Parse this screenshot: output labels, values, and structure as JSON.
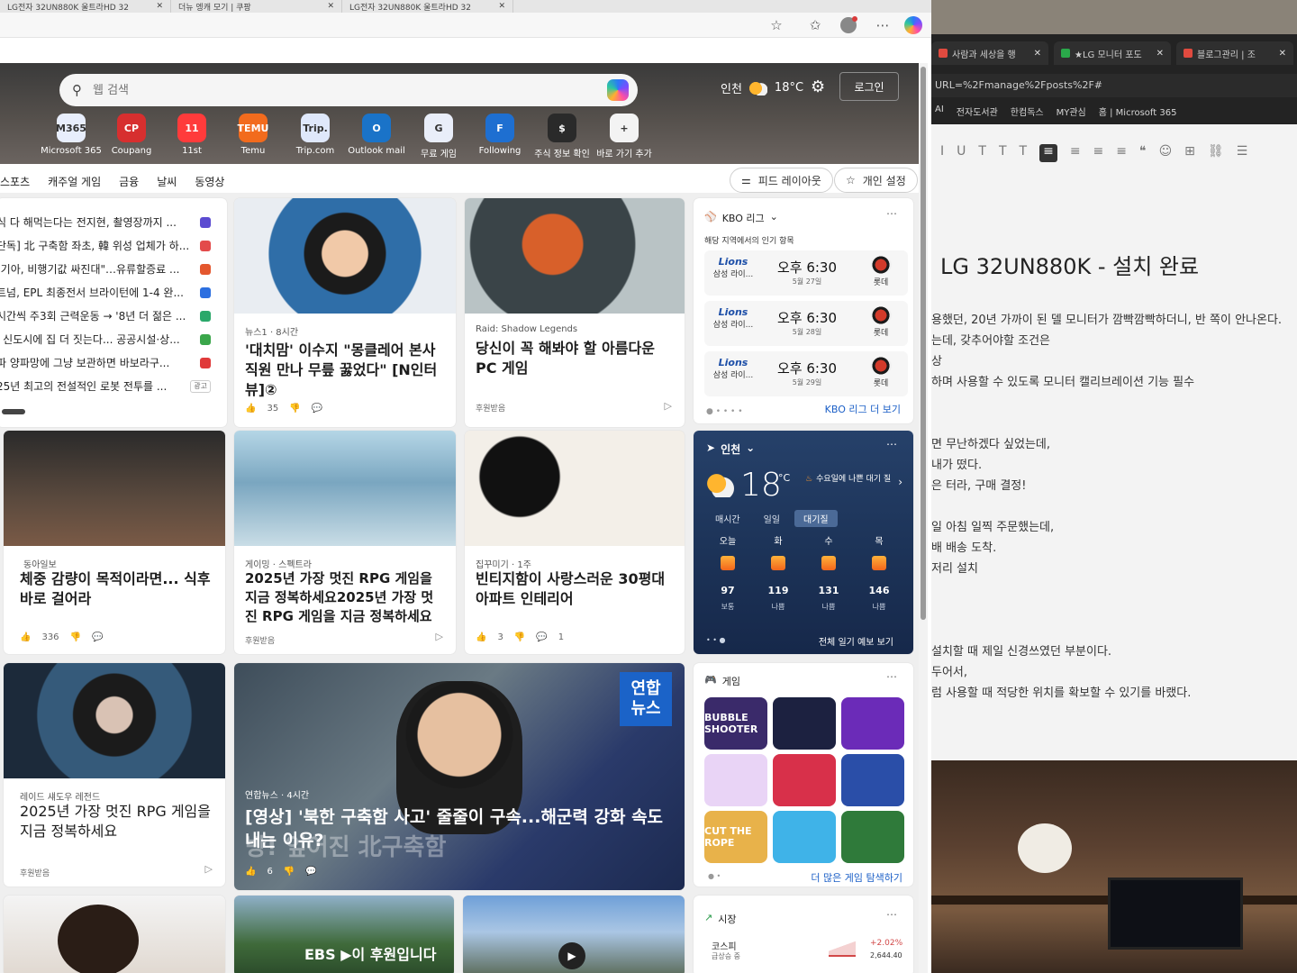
{
  "front_tabs": [
    {
      "label": "LG전자 32UN880K 울트라HD 32"
    },
    {
      "label": "더뉴 엥캐 모기 | 쿠팡"
    },
    {
      "label": "LG전자 32UN880K 울트라HD 32"
    }
  ],
  "search": {
    "placeholder": "웹 검색"
  },
  "header": {
    "weather_city": "인천",
    "weather_temp": "18°C",
    "login": "로그인"
  },
  "quick_links": [
    {
      "label": "Microsoft 365",
      "tile": "M365",
      "color": "#e8eefc"
    },
    {
      "label": "Coupang",
      "tile": "CP",
      "color": "#d72f2f"
    },
    {
      "label": "11st",
      "tile": "11",
      "color": "#ff3b3b"
    },
    {
      "label": "Temu",
      "tile": "TEMU",
      "color": "#f26b1d"
    },
    {
      "label": "Trip.com",
      "tile": "Trip.",
      "color": "#dfe8fb"
    },
    {
      "label": "Outlook mail",
      "tile": "O",
      "color": "#1a73c8"
    },
    {
      "label": "무료 게임",
      "tile": "G",
      "color": "#e9eef9"
    },
    {
      "label": "Following",
      "tile": "F",
      "color": "#1e6fd1"
    },
    {
      "label": "주식 정보 확인",
      "tile": "$",
      "color": "#2a2a2a"
    },
    {
      "label": "바로 가기 추가",
      "tile": "+",
      "color": "#f3f3f3"
    }
  ],
  "nav": {
    "items": [
      "스포츠",
      "캐주얼 게임",
      "금융",
      "날씨",
      "동영상"
    ],
    "feed_layout": "피드 레이아웃",
    "personalize": "개인 설정"
  },
  "headlines": [
    {
      "text": "식 다 해먹는다는 전지현, 촬영장까지 ...",
      "color": "#5b4bd1"
    },
    {
      "text": "단독] 北 구축함 좌초, 韓 위성 업체가 하...",
      "color": "#e34b4b"
    },
    {
      "text": "[기아, 비행기값 싸진대\"…유류할증료 ...",
      "color": "#e4572e"
    },
    {
      "text": "트넘, EPL 최종전서 브라이턴에 1-4 완...",
      "color": "#2c6fe0"
    },
    {
      "text": "시간씩 주3회 근력운동 → '8년 더 젊은 ...",
      "color": "#2aa86a"
    },
    {
      "text": "l 신도시에 집 더 짓는다... 공공시설·상...",
      "color": "#3aa64a"
    },
    {
      "text": "파 양파망에 그냥 보관하면 바보라구...",
      "color": "#e03a3a"
    },
    {
      "text": "25년 최고의 전설적인 로봇 전투를 ...",
      "badge": "광고",
      "color": "#cccccc"
    }
  ],
  "cards": {
    "interview": {
      "source": "뉴스1 · 8시간",
      "title": "'대치맘' 이수지 \"몽클레어 본사 직원 만나 무릎 꿇었다\" [N인터뷰]②",
      "likes": "35"
    },
    "shadow": {
      "source": "Raid: Shadow Legends",
      "title": "당신이 꼭 해봐야 할 아름다운 PC 게임",
      "sponsor": "후원받음"
    },
    "diet": {
      "source": "동아일보",
      "title": "체중 감량이 목적이라면... 식후 바로 걸어라",
      "likes": "336"
    },
    "rpg": {
      "source": "게이밍 · 스펙트라",
      "title": "2025년 가장 멋진 RPG 게임을 지금 정복하세요2025년 가장 멋진 RPG 게임을 지금 정복하세요",
      "sponsor": "후원받음"
    },
    "interior": {
      "source": "집꾸미기 · 1주",
      "title": "빈티지함이 사랑스러운 30평대 아파트 인테리어",
      "likes": "3",
      "comments": "1"
    },
    "raid2": {
      "source": "레이드 섀도우 레전드",
      "title": "2025년 가장 멋진 RPG 게임을 지금 정복하세요",
      "sponsor": "후원받음"
    },
    "yonhap": {
      "badge": "연합\n뉴스",
      "source": "연합뉴스 · 4시간",
      "title": "[영상] '북한 구축함 사고' 줄줄이 구속...해군력 강화 속도내는 이유?",
      "overlay": "방! 엎어진 北구축함",
      "likes": "6"
    },
    "ebs": {
      "overlay": "EBS ▶이 후원입니다"
    }
  },
  "kbo": {
    "title": "KBO 리그",
    "subtitle": "해당 지역에서의 인기 항목",
    "games": [
      {
        "home": "삼성 라이...",
        "home_logo": "Lions",
        "time": "오후 6:30",
        "date": "5월 27일",
        "away": "롯데"
      },
      {
        "home": "삼성 라이...",
        "home_logo": "Lions",
        "time": "오후 6:30",
        "date": "5월 28일",
        "away": "롯데"
      },
      {
        "home": "삼성 라이...",
        "home_logo": "Lions",
        "time": "오후 6:30",
        "date": "5월 29일",
        "away": "롯데"
      }
    ],
    "more": "KBO 리그 더 보기"
  },
  "weather": {
    "city": "인천",
    "temp": "18",
    "unit": "°C",
    "alert": "수요일에 나쁜 대기 질",
    "tabs": [
      "매시간",
      "일일",
      "대기질"
    ],
    "days": [
      {
        "day": "오늘",
        "value": "97",
        "level": "보통"
      },
      {
        "day": "화",
        "value": "119",
        "level": "나쁨"
      },
      {
        "day": "수",
        "value": "131",
        "level": "나쁨"
      },
      {
        "day": "목",
        "value": "146",
        "level": "나쁨"
      }
    ],
    "more": "전체 일기 예보 보기"
  },
  "games": {
    "title": "게임",
    "tiles": [
      {
        "label": "BUBBLE SHOOTER",
        "color": "#3a2a6a"
      },
      {
        "label": "",
        "color": "#1c2140"
      },
      {
        "label": "",
        "color": "#6b2bb8"
      },
      {
        "label": "",
        "color": "#e9d4f6"
      },
      {
        "label": "",
        "color": "#d8304a"
      },
      {
        "label": "",
        "color": "#2a4ea8"
      },
      {
        "label": "CUT THE ROPE",
        "color": "#e8b24a"
      },
      {
        "label": "",
        "color": "#3fb3e8"
      },
      {
        "label": "",
        "color": "#2f7a3a"
      }
    ],
    "more": "더 많은 게임 탐색하기"
  },
  "market": {
    "title": "시장",
    "name": "코스피",
    "status": "급상승 중",
    "change": "+2.02%",
    "value": "2,644.40"
  },
  "back": {
    "tabs": [
      {
        "label": "사람과 세상을 행"
      },
      {
        "label": "★LG 모니터 포도"
      },
      {
        "label": "블로그관리 | 조"
      }
    ],
    "address": "URL=%2Fmanage%2Fposts%2F#",
    "bookmarks": [
      "AI",
      "전자도서관",
      "한컴독스",
      "MY관심",
      "홈 | Microsoft 365"
    ],
    "post_title": "LG 32UN880K - 설치 완료",
    "lines": [
      "용했던, 20년 가까이 된 델 모니터가 깜빡깜빡하더니, 반 쪽이 안나온다.",
      "는데, 갖추어야할 조건은",
      "상",
      "하며 사용할 수 있도록 모니터 캘리브레이션 기능 필수",
      "",
      "",
      "면 무난하겠다 싶었는데,",
      "내가 떴다.",
      "은 터라, 구매 결정!",
      "",
      "일 아침 일찍 주문했는데,",
      "배 배송 도착.",
      "저리 설치",
      "",
      "",
      "",
      "설치할 때 제일 신경쓰였던 부분이다.",
      "두어서,",
      "럼 사용할 때 적당한 위치를 확보할 수 있기를 바랬다."
    ]
  }
}
